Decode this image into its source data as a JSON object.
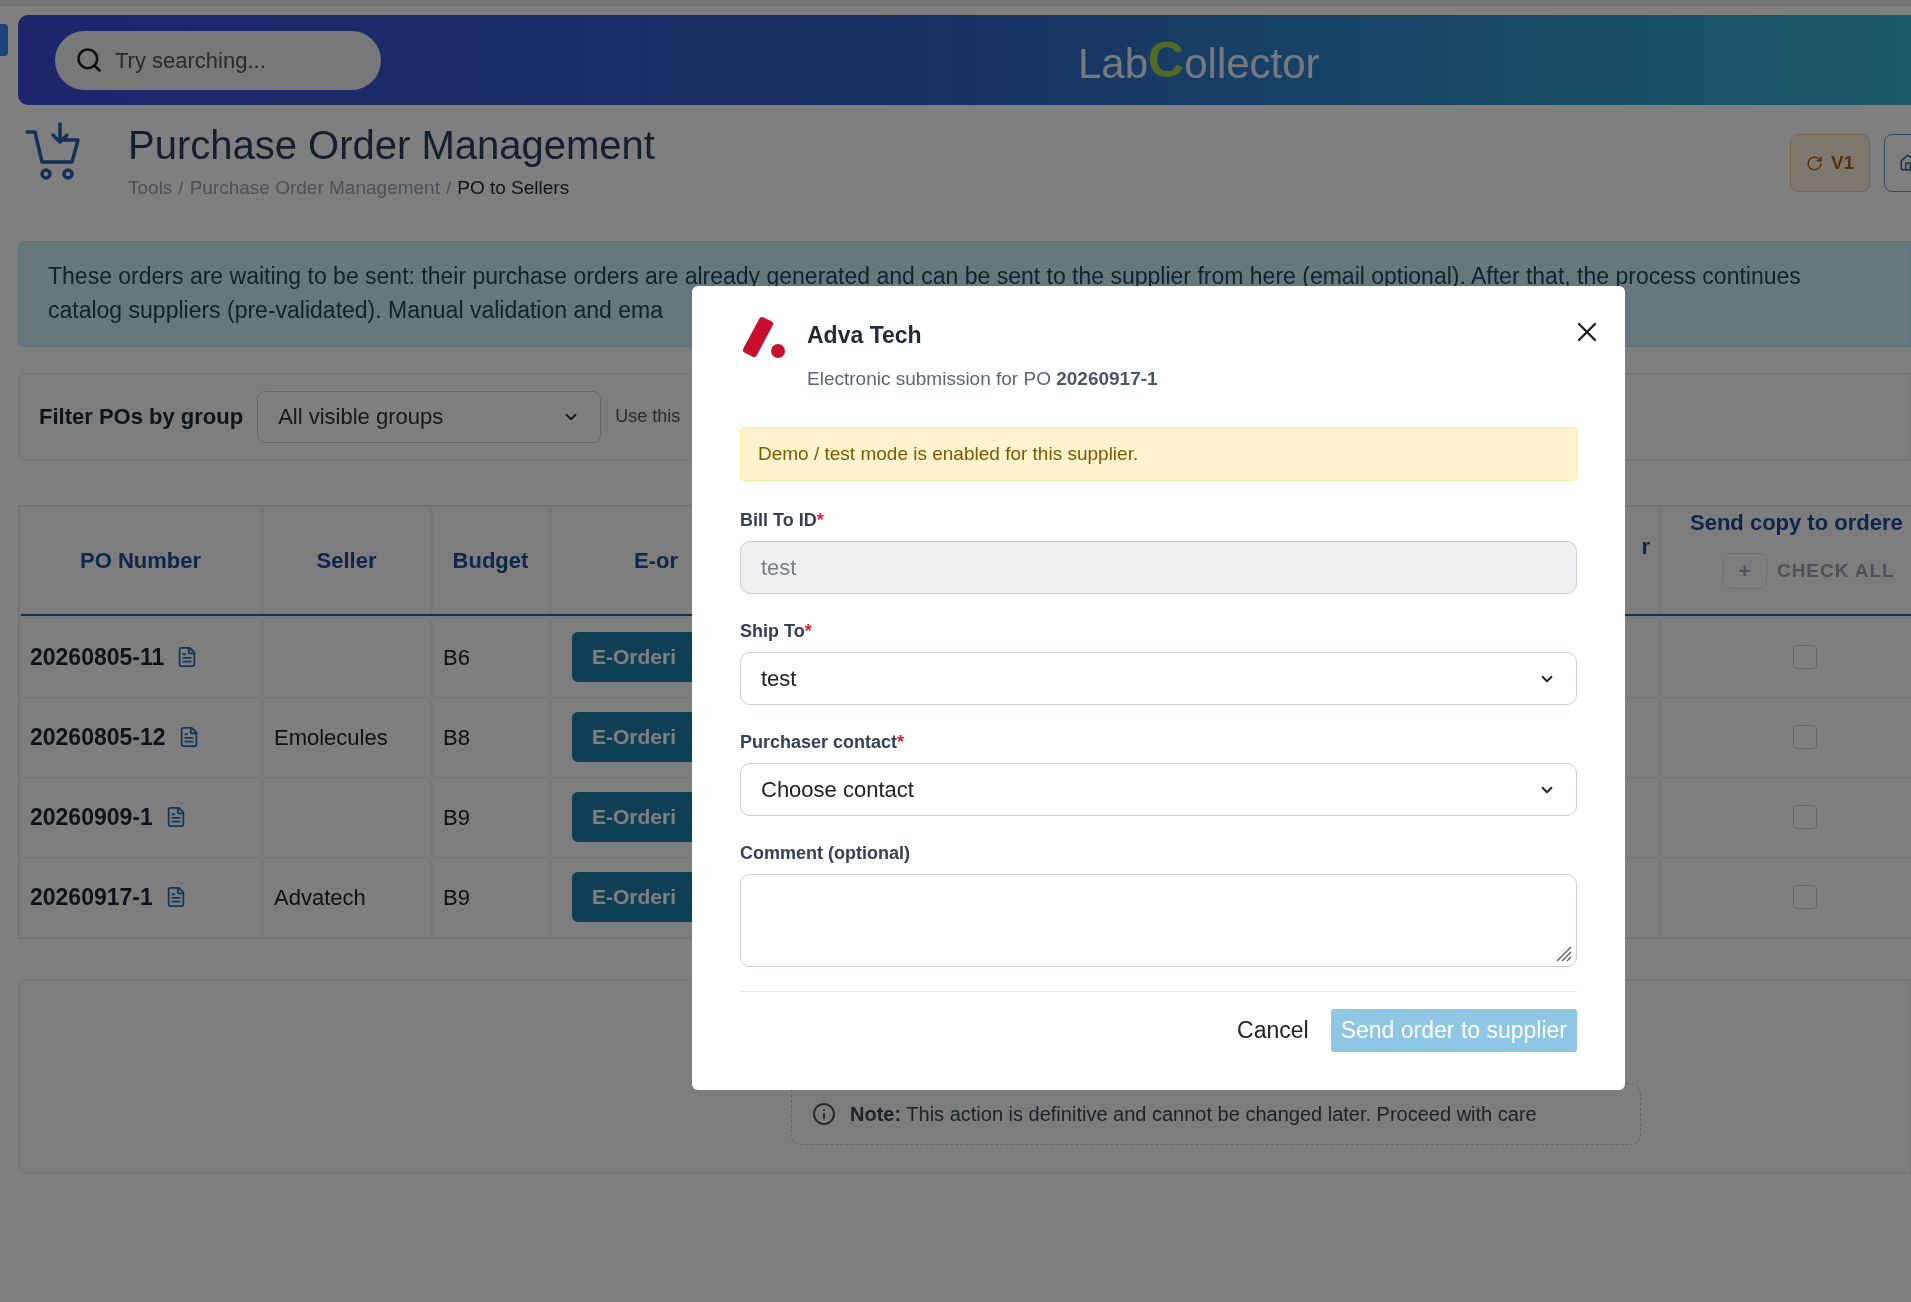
{
  "header": {
    "search": {
      "placeholder": "Try searching..."
    },
    "logo": {
      "before": "Lab",
      "mark": "C",
      "after": "ollector"
    }
  },
  "page": {
    "title": "Purchase Order Management",
    "breadcrumb": [
      {
        "label": "Tools",
        "current": false,
        "separator": "/"
      },
      {
        "label": "Purchase Order Management",
        "current": false,
        "separator": "/"
      },
      {
        "label": "PO to Sellers",
        "current": true
      }
    ],
    "toolbar": [
      {
        "kind": "version",
        "label": "V1"
      },
      {
        "kind": "home"
      }
    ]
  },
  "banner": {
    "lines": [
      "These orders are waiting to be sent: their purchase orders are already generated and can be sent to the supplier from here (email optional). After that, the process continues",
      "catalog suppliers (pre-validated). Manual validation and ema"
    ]
  },
  "filter": {
    "label": "Filter POs by group",
    "value": "All visible groups",
    "hint": "Use this"
  },
  "table": {
    "columns": [
      "PO Number",
      "Seller",
      "Budget",
      "E-or",
      "r",
      "Send copy to ordere"
    ],
    "check_all": {
      "icon": "+",
      "label": "CHECK ALL"
    },
    "rows": [
      {
        "po": "20260805-11",
        "budget": "B6",
        "action": "E-Orderi",
        "copy_checked": false
      },
      {
        "po": "20260805-12",
        "seller": "Emolecules",
        "budget": "B8",
        "action": "E-Orderi",
        "copy_checked": false
      },
      {
        "po": "20260909-1",
        "budget": "B9",
        "action": "E-Orderi",
        "copy_checked": false
      },
      {
        "po": "20260917-1",
        "seller": "Advatech",
        "budget": "B9",
        "action": "E-Orderi",
        "copy_checked": false
      }
    ]
  },
  "note": {
    "text": "**Note:** This action is definitive and cannot be changed later. Proceed with care"
  },
  "modal": {
    "title": "Adva Tech",
    "subtitle": "Electronic submission for PO **20260917-1**",
    "alert": "Demo / test mode is enabled for this supplier.",
    "fields": [
      {
        "kind": "input",
        "label": "Bill To ID",
        "required_mark": "*",
        "value": "test",
        "disabled": true
      },
      {
        "kind": "select",
        "label": "Ship To",
        "required_mark": "*",
        "value": "test"
      },
      {
        "kind": "select",
        "label": "Purchaser contact",
        "required_mark": "*",
        "value": "Choose contact"
      },
      {
        "kind": "textarea",
        "label": "Comment (optional)"
      }
    ],
    "cancel": "Cancel",
    "submit": {
      "label": "Send order to supplier",
      "disabled": true
    }
  }
}
